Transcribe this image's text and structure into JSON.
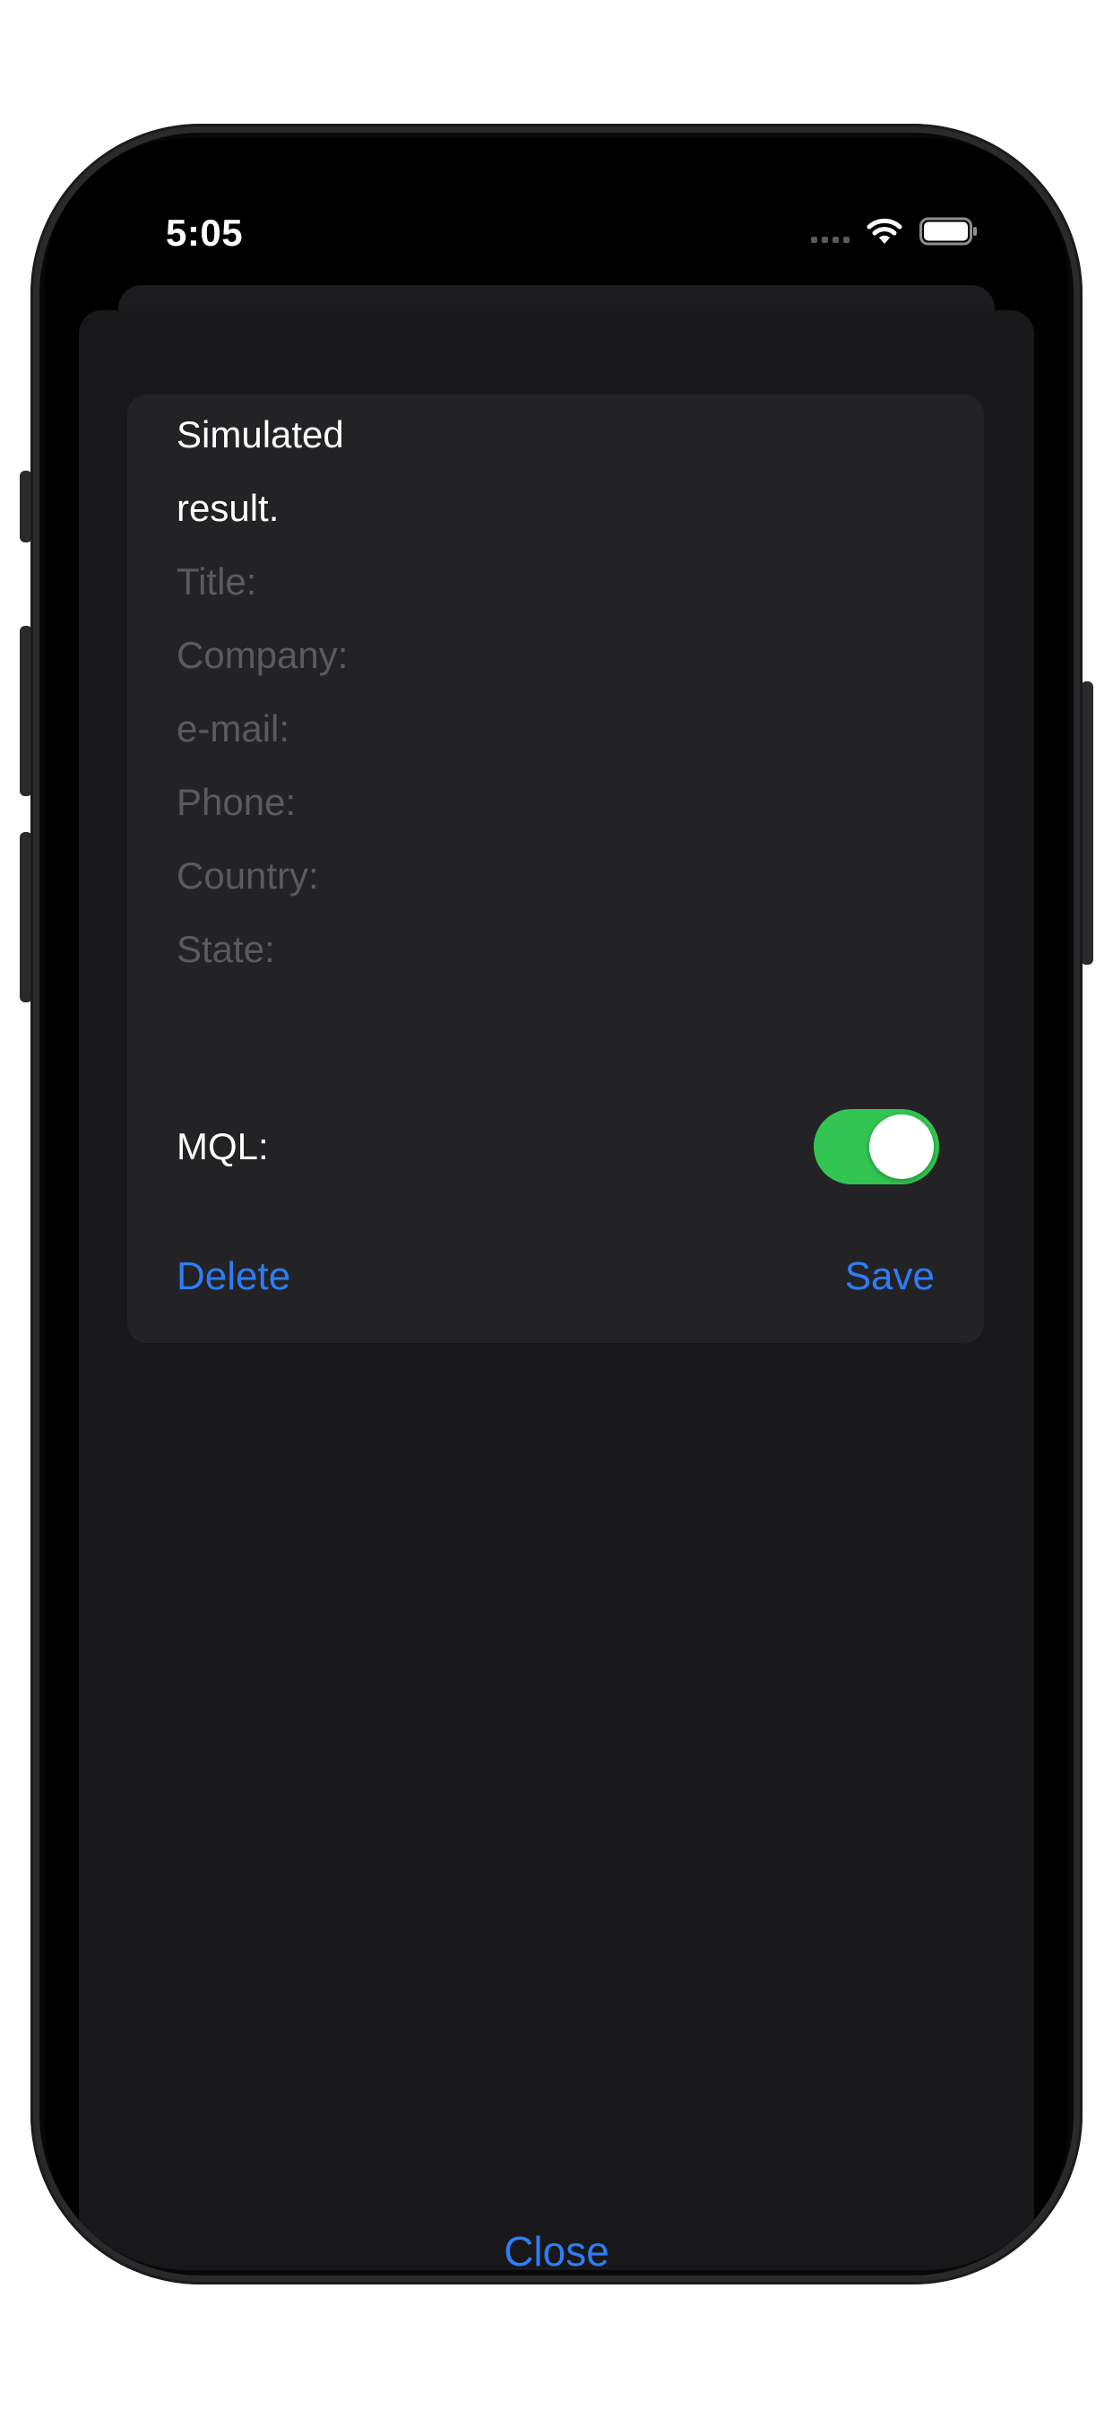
{
  "status_bar": {
    "time": "5:05",
    "icons": [
      "cellular-signal-icon",
      "wifi-icon",
      "battery-icon"
    ]
  },
  "card": {
    "result_line1": "Simulated",
    "result_line2": "result.",
    "fields": [
      {
        "placeholder": "Title:"
      },
      {
        "placeholder": "Company:"
      },
      {
        "placeholder": "e-mail:"
      },
      {
        "placeholder": "Phone:"
      },
      {
        "placeholder": "Country:"
      },
      {
        "placeholder": "State:"
      }
    ],
    "mql_label": "MQL:",
    "mql_enabled": true,
    "delete_label": "Delete",
    "save_label": "Save"
  },
  "close_label": "Close",
  "colors": {
    "accent": "#2f7cf6",
    "toggle_on": "#32c552",
    "sheet_bg": "#18181a",
    "card_bg": "#232325"
  }
}
